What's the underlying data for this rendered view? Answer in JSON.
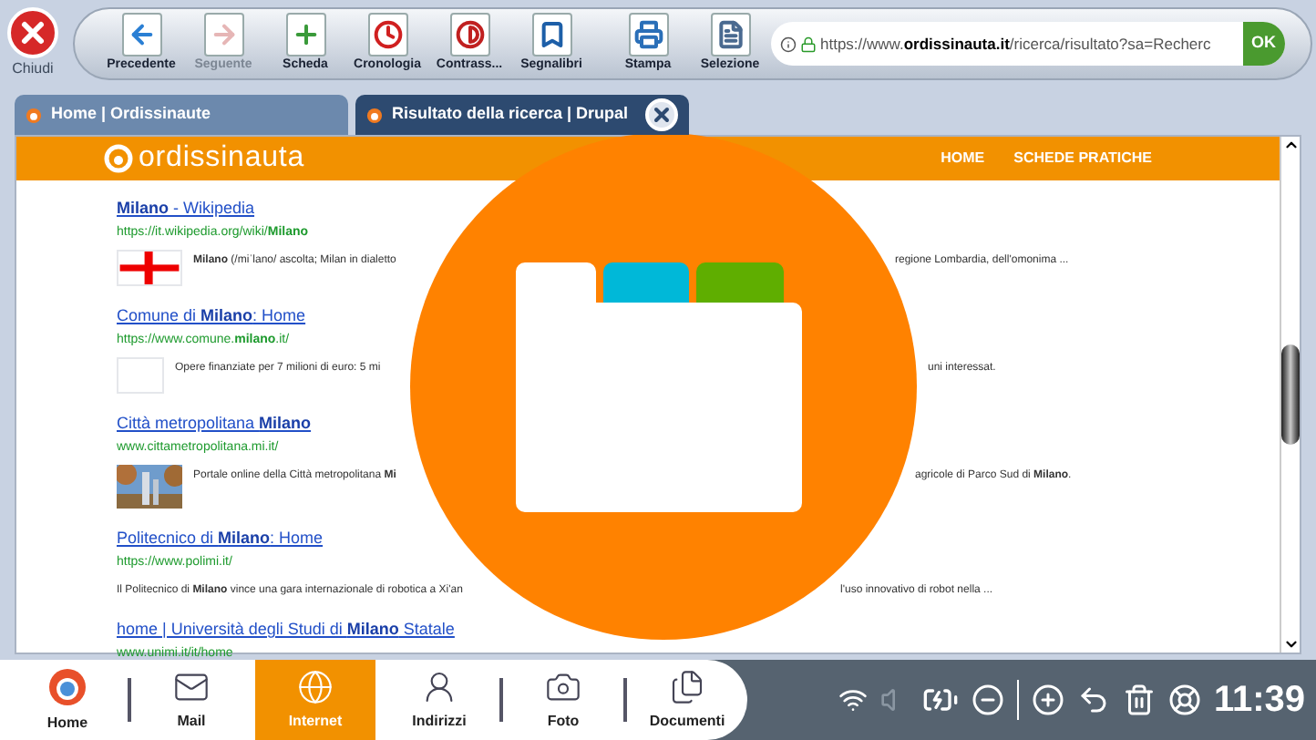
{
  "close_button": {
    "label": "Chiudi"
  },
  "toolbar": [
    {
      "label": "Precedente",
      "kind": "back",
      "disabled": false
    },
    {
      "label": "Seguente",
      "kind": "forward",
      "disabled": true
    },
    {
      "label": "Scheda",
      "kind": "tab",
      "disabled": false
    },
    {
      "label": "Cronologia",
      "kind": "history",
      "disabled": false
    },
    {
      "label": "Contrass...",
      "kind": "contrast",
      "disabled": false
    },
    {
      "label": "Segnalibri",
      "kind": "bookmarks",
      "disabled": false
    },
    {
      "label": "Stampa",
      "kind": "print",
      "disabled": false
    },
    {
      "label": "Selezione",
      "kind": "select",
      "disabled": false
    }
  ],
  "address_bar": {
    "url": "https://www.**ordissinauta.it**/ricerca/risultato?sa=Recherc",
    "go": "OK"
  },
  "tabs": [
    {
      "title": "Home | Ordissinaute",
      "selected": false
    },
    {
      "title": "Risultato della ricerca | Drupal",
      "selected": true
    }
  ],
  "site_header": {
    "logo": "ordissinauta",
    "nav": [
      "HOME",
      "SCHEDE PRATICHE"
    ]
  },
  "results": [
    {
      "title": "**Milano** - Wikipedia",
      "url": "https://it.wikipedia.org/wiki/**Milano**",
      "kind": "flag",
      "snippet_left": "**Milano** (/miˈlano/ ascolta; Milan in dialetto",
      "snippet_right": "regione Lombardia, dell'omonima  ..."
    },
    {
      "title": "Comune di **Milano**: Home",
      "url": "https://www.comune.**milano**.it/",
      "kind": "blank",
      "snippet_left": "Opere finanziate per 7 milioni di euro: 5 mi",
      "snippet_right": "uni interessat."
    },
    {
      "title": "Città metropolitana **Milano**",
      "url": "www.cittametropolitana.mi.it/",
      "snippet_left": "Portale online della Città metropolitana **Mi**",
      "snippet_right": "agricole di Parco Sud di **Milano**."
    },
    {
      "title": "Politecnico di **Milano**: Home",
      "url": "https://www.polimi.it/",
      "snippet_left": "Il Politecnico di **Milano** vince una gara internazionale di robotica a Xi'an",
      "snippet_right": "l'uso innovativo di robot nella ..."
    },
    {
      "title": "home | Università degli Studi di **Milano** Statale",
      "url": "www.unimi.it/it/home"
    }
  ],
  "dock": [
    {
      "label": "Home",
      "kind": "home",
      "selected": false
    },
    {
      "label": "Mail",
      "kind": "mail",
      "selected": false
    },
    {
      "label": "Internet",
      "kind": "internet",
      "selected": true
    },
    {
      "label": "Indirizzi",
      "kind": "contacts",
      "selected": false
    },
    {
      "label": "Foto",
      "selected": false
    },
    {
      "label": "Documenti",
      "kind": "documents",
      "selected": false
    }
  ],
  "status": {
    "time": "11:39"
  }
}
